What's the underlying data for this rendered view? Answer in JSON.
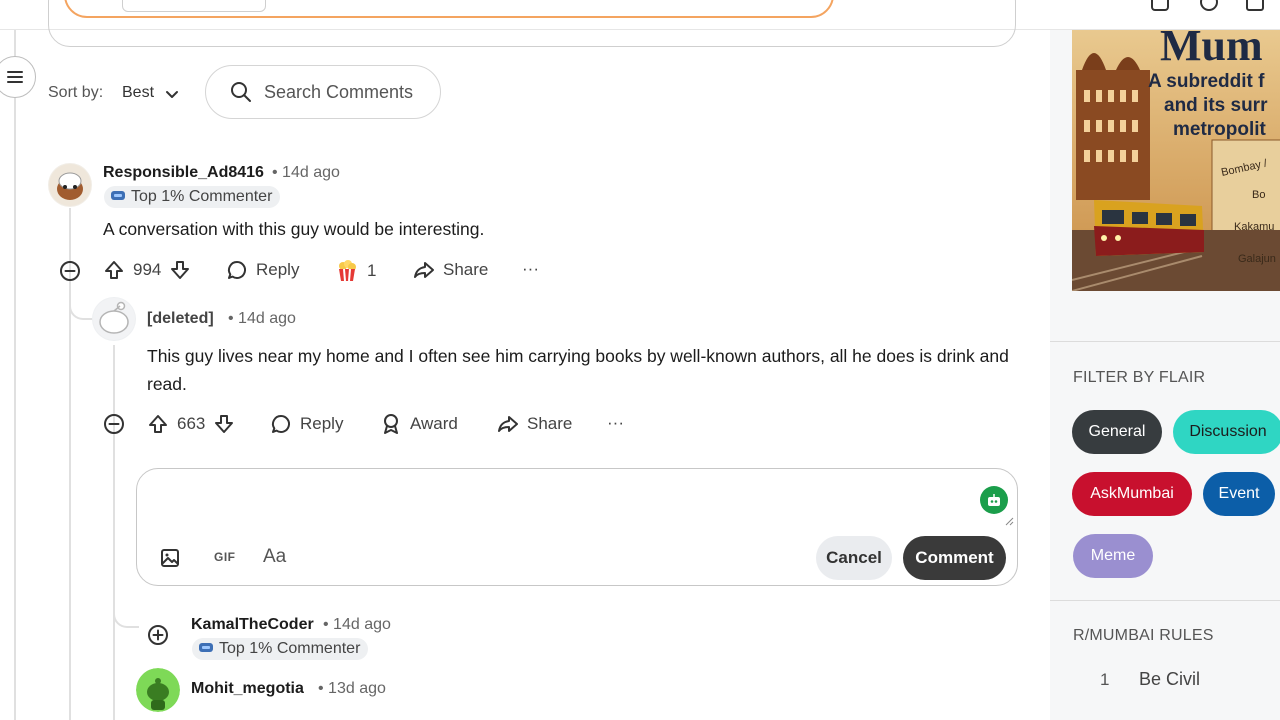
{
  "sort": {
    "label": "Sort by:",
    "value": "Best"
  },
  "search": {
    "placeholder": "Search Comments"
  },
  "comments": [
    {
      "username": "Responsible_Ad8416",
      "time": "• 14d ago",
      "badge": "Top 1% Commenter",
      "body": "A conversation with this guy would be interesting.",
      "votes": "994",
      "reply_label": "Reply",
      "award_count": "1",
      "share_label": "Share",
      "more_label": "···"
    },
    {
      "username": "[deleted]",
      "time": "• 14d ago",
      "body": "This guy lives near my home and I often see him carrying books by well-known authors, all he does is drink and read.",
      "votes": "663",
      "reply_label": "Reply",
      "award_label": "Award",
      "share_label": "Share",
      "more_label": "···"
    },
    {
      "username": "KamalTheCoder",
      "time": "• 14d ago",
      "badge": "Top 1% Commenter"
    },
    {
      "username": "Mohit_megotia",
      "time": "• 13d ago"
    }
  ],
  "composer": {
    "gif_label": "GIF",
    "format_label": "Aa",
    "cancel_label": "Cancel",
    "submit_label": "Comment"
  },
  "sidebar": {
    "banner_lines": [
      "Mum",
      "A subreddit f",
      "and its surr",
      "metropolit"
    ],
    "banner_tags": [
      "Bombay /",
      "Bo",
      "Kakamu",
      "Galajun"
    ],
    "filter_title": "FILTER BY FLAIR",
    "flairs": [
      {
        "label": "General",
        "bg": "#373c3f",
        "fg": "#ffffff"
      },
      {
        "label": "Discussion",
        "bg": "#2fd6c3",
        "fg": "#1c1c1c"
      },
      {
        "label": "AskMumbai",
        "bg": "#c8102e",
        "fg": "#ffffff"
      },
      {
        "label": "Event",
        "bg": "#0c5ea8",
        "fg": "#ffffff"
      },
      {
        "label": "Meme",
        "bg": "#9a8fd0",
        "fg": "#ffffff"
      }
    ],
    "rules_title": "R/MUMBAI RULES",
    "rules": [
      {
        "num": "1",
        "text": "Be Civil"
      }
    ]
  }
}
